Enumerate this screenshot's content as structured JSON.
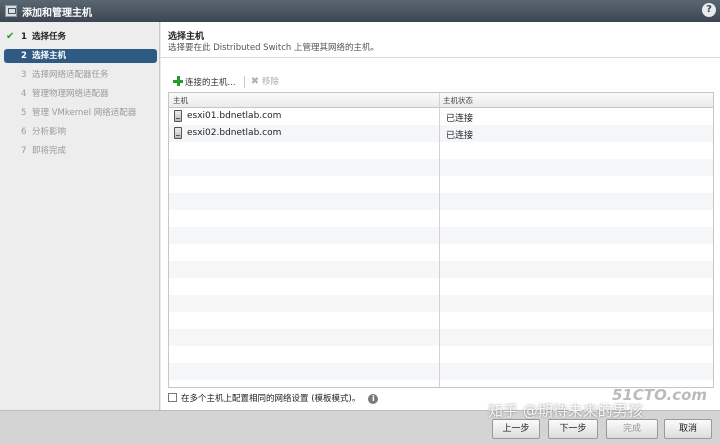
{
  "window": {
    "title": "添加和管理主机"
  },
  "steps": [
    {
      "num": "1",
      "label": "选择任务",
      "state": "done"
    },
    {
      "num": "2",
      "label": "选择主机",
      "state": "active"
    },
    {
      "num": "3",
      "label": "选择网络适配器任务",
      "state": "pending"
    },
    {
      "num": "4",
      "label": "管理物理网络适配器",
      "state": "pending"
    },
    {
      "num": "5",
      "label": "管理 VMkernel 网络适配器",
      "state": "pending"
    },
    {
      "num": "6",
      "label": "分析影响",
      "state": "pending"
    },
    {
      "num": "7",
      "label": "即将完成",
      "state": "pending"
    }
  ],
  "header": {
    "title": "选择主机",
    "subtitle": "选择要在此 Distributed Switch 上管理其网络的主机。"
  },
  "toolbar": {
    "connect_label": "连接的主机...",
    "remove_label": "移除"
  },
  "table": {
    "columns": [
      "主机",
      "主机状态"
    ],
    "rows": [
      {
        "host": "esxi01.bdnetlab.com",
        "status": "已连接"
      },
      {
        "host": "esxi02.bdnetlab.com",
        "status": "已连接"
      }
    ]
  },
  "footer": {
    "checkbox_label": "在多个主机上配置相同的网络设置 (模板模式)。"
  },
  "buttons": {
    "back": "上一步",
    "next": "下一步",
    "finish": "完成",
    "cancel": "取消"
  },
  "watermarks": {
    "logo": "51CTO.com",
    "zhihu": "知乎 @期待未来的男孩"
  }
}
